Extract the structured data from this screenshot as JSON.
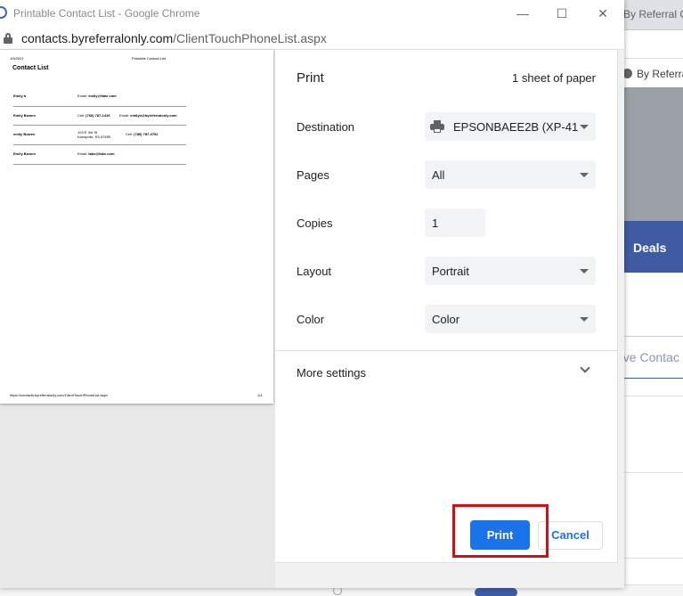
{
  "window": {
    "title": "Printable Contact List - Google Chrome",
    "url_host": "contacts.byreferralonly.com",
    "url_path": "/ClientTouchPhoneList.aspx",
    "controls": {
      "minimize": "—",
      "maximize": "☐",
      "close": "✕"
    }
  },
  "background": {
    "tab_title": "By Referral O",
    "bookmark_label": "By Referra",
    "deals_label": "Deals",
    "move_contacts_label": "ove Contac"
  },
  "preview": {
    "date": "1/9/2021",
    "header": "Printable Contact List",
    "title": "Contact List",
    "rows": [
      {
        "name": "Emily b",
        "col1_label": "Email:",
        "col1_value": "emily@fake.com",
        "col1_extra": "",
        "col2_label": "",
        "col2_value": ""
      },
      {
        "name": "Emily Bowen",
        "col1_label": "Cell:",
        "col1_value": "(760) 787-1419",
        "col1_extra": "",
        "col2_label": "Email:",
        "col2_value": "emilyb@byreferralonly.com"
      },
      {
        "name": "emily Bowen",
        "col1_label": "",
        "col1_value": "",
        "col1_extra": "103 E 3rd St",
        "col1_extra2": "Kasopolis, KS 67659",
        "col2_label": "Cell:",
        "col2_value": "(785) 787-0792"
      },
      {
        "name": "Emily Bowen",
        "col1_label": "Email:",
        "col1_value": "fake@fake.com",
        "col1_extra": "",
        "col2_label": "",
        "col2_value": ""
      }
    ],
    "footer_url": "https://contacts.byreferralonly.com/ClientTouchPhoneList.aspx",
    "footer_page": "1/1"
  },
  "print": {
    "title": "Print",
    "sheets": "1 sheet of paper",
    "destination": {
      "label": "Destination",
      "value": "EPSONBAEE2B (XP-41"
    },
    "pages": {
      "label": "Pages",
      "value": "All"
    },
    "copies": {
      "label": "Copies",
      "value": "1"
    },
    "layout": {
      "label": "Layout",
      "value": "Portrait"
    },
    "color": {
      "label": "Color",
      "value": "Color"
    },
    "more_settings": "More settings",
    "print_button": "Print",
    "cancel_button": "Cancel"
  },
  "colors": {
    "accent": "#1a73e8",
    "highlight_box": "#d40f14",
    "background_nav": "#3f5ba3"
  }
}
